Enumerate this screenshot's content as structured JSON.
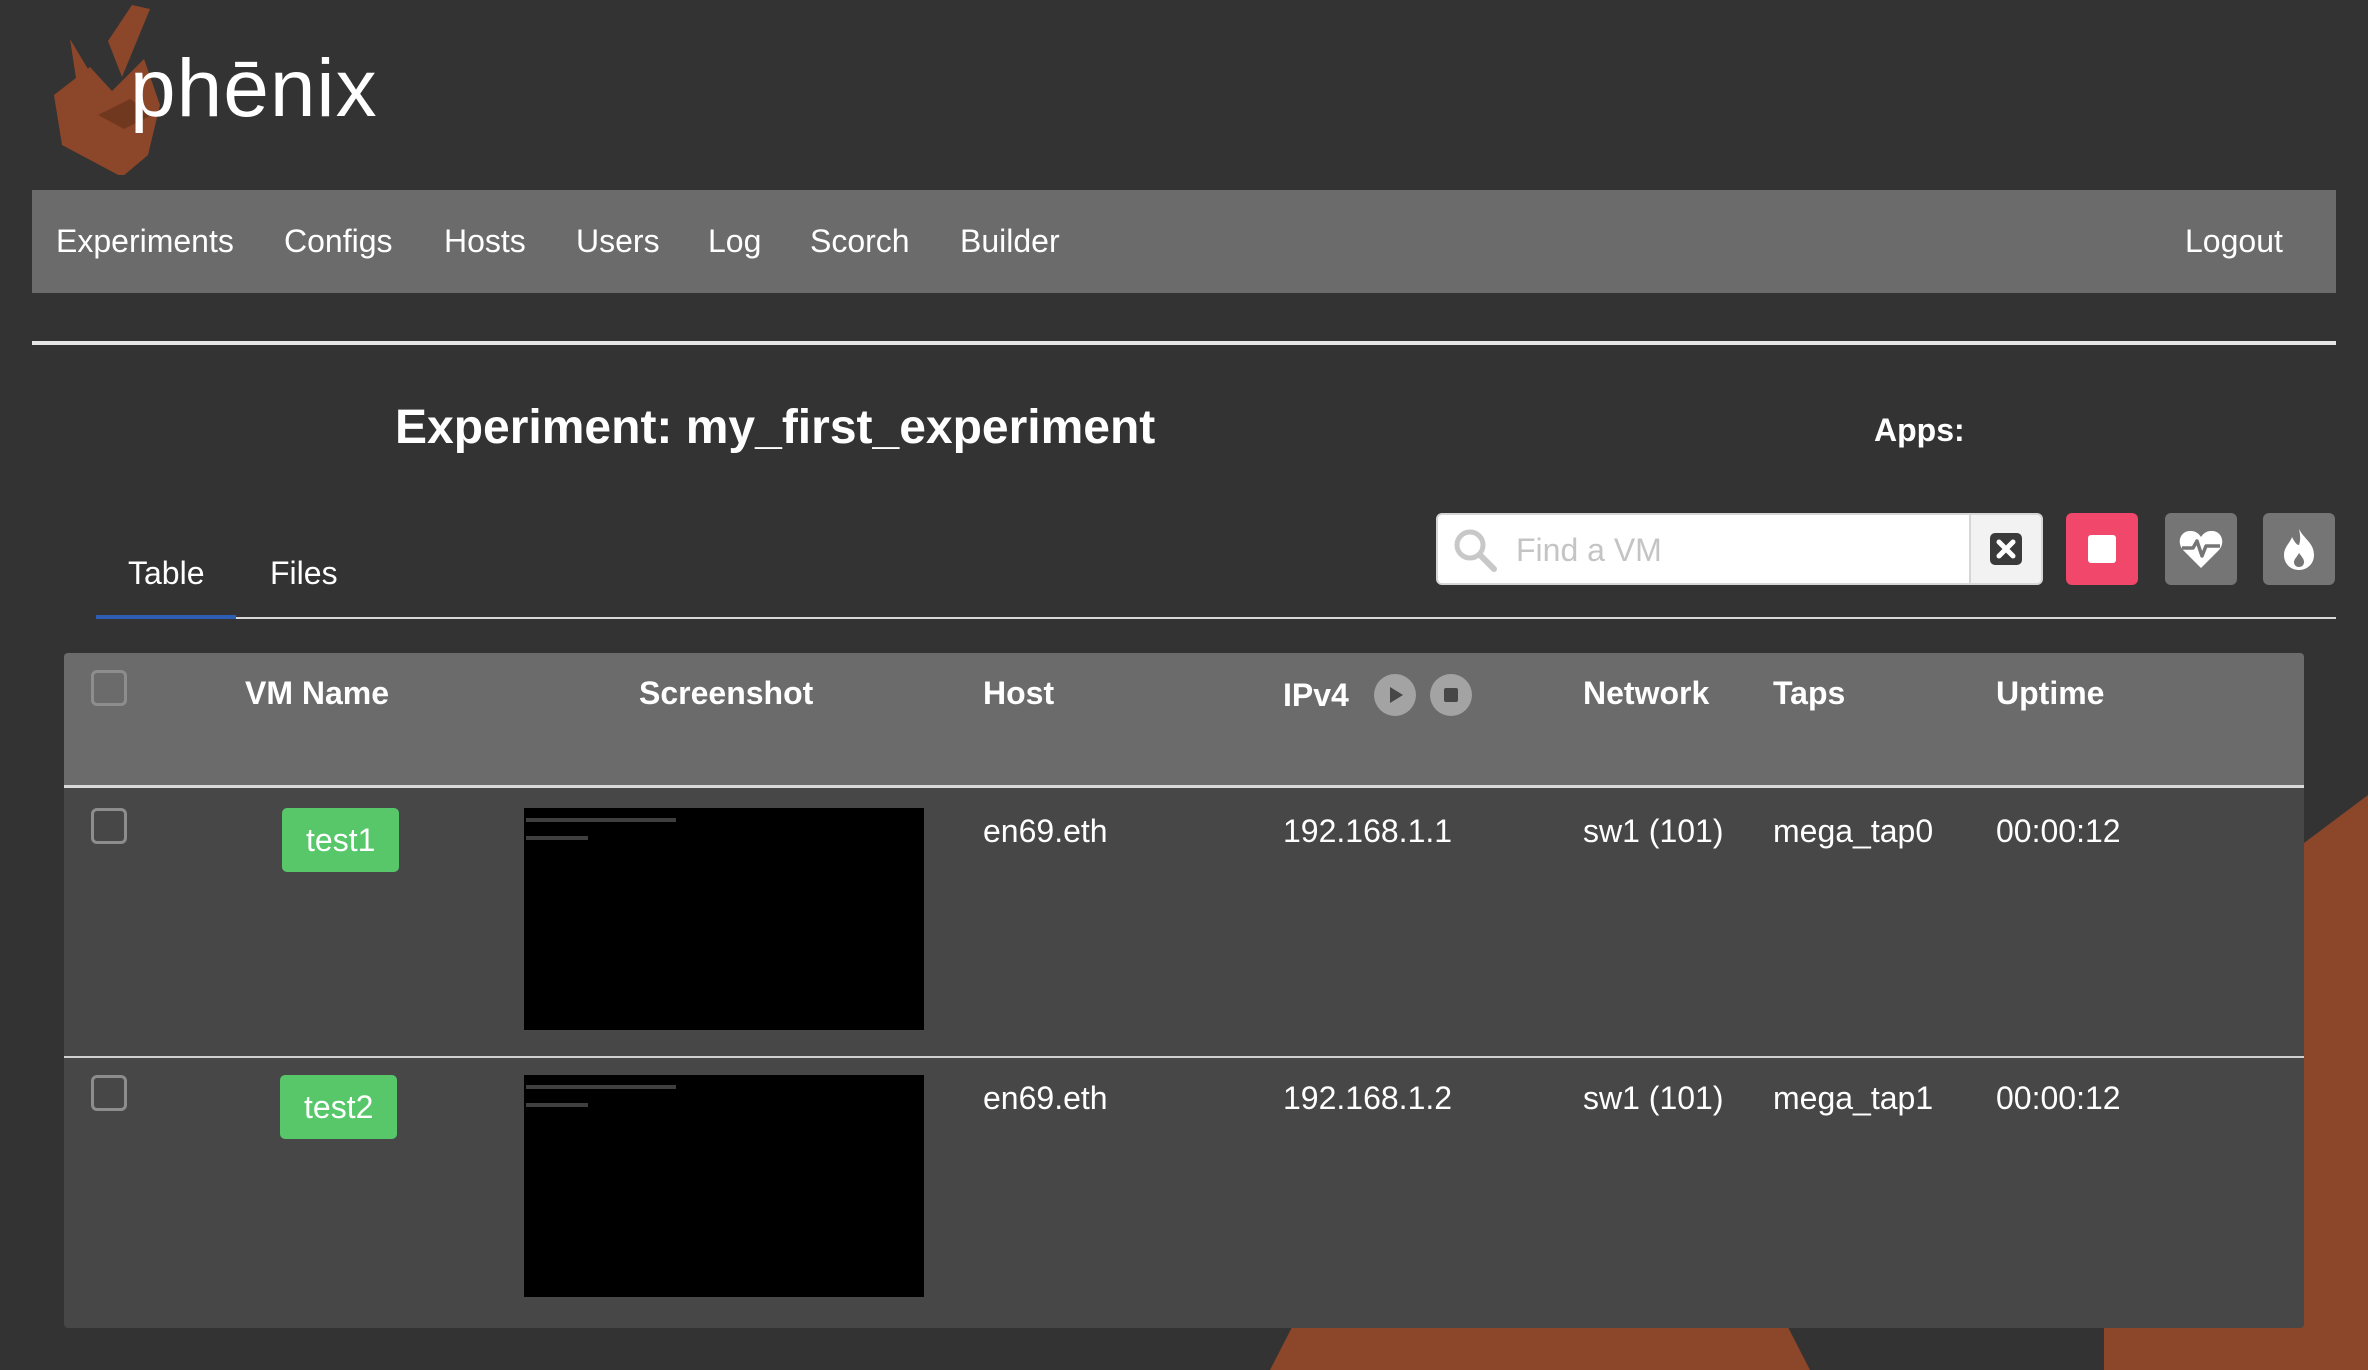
{
  "brand": {
    "name": "phēnix",
    "accent": "#8c462a"
  },
  "nav": {
    "items": [
      "Experiments",
      "Configs",
      "Hosts",
      "Users",
      "Log",
      "Scorch",
      "Builder"
    ],
    "logout": "Logout"
  },
  "experiment": {
    "title": "Experiment: my_first_experiment",
    "apps_label": "Apps:"
  },
  "tabs": [
    {
      "label": "Table",
      "active": true
    },
    {
      "label": "Files",
      "active": false
    }
  ],
  "search": {
    "placeholder": "Find a VM",
    "value": ""
  },
  "toolbar": {
    "clear_icon": "close-icon",
    "stop_icon": "stop-icon",
    "health_icon": "heartbeat-icon",
    "fire_icon": "fire-icon",
    "stop_color": "#f1476a"
  },
  "table": {
    "headers": {
      "vm_name": "VM Name",
      "screenshot": "Screenshot",
      "host": "Host",
      "ipv4": "IPv4",
      "network": "Network",
      "taps": "Taps",
      "uptime": "Uptime"
    },
    "rows": [
      {
        "name": "test1",
        "host": "en69.eth",
        "ipv4": "192.168.1.1",
        "network": "sw1 (101)",
        "taps": "mega_tap0",
        "uptime": "00:00:12"
      },
      {
        "name": "test2",
        "host": "en69.eth",
        "ipv4": "192.168.1.2",
        "network": "sw1 (101)",
        "taps": "mega_tap1",
        "uptime": "00:00:12"
      }
    ]
  }
}
